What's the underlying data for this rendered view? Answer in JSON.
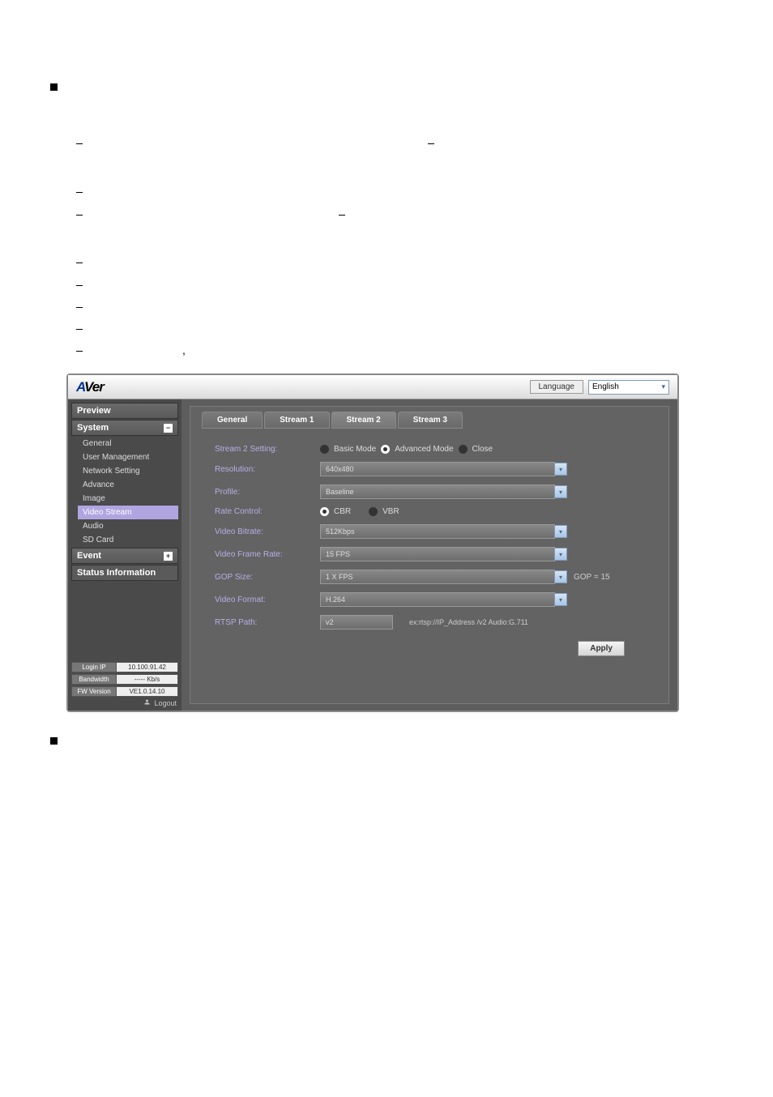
{
  "header": {
    "logo_a": "A",
    "logo_v": "V",
    "logo_er": "er",
    "language_label": "Language",
    "language_value": "English"
  },
  "sidebar": {
    "preview_label": "Preview",
    "system_label": "System",
    "system_items": [
      "General",
      "User Management",
      "Network Setting",
      "Advance",
      "Image",
      "Video Stream",
      "Audio",
      "SD Card"
    ],
    "event_label": "Event",
    "status_label": "Status Information",
    "stats": [
      {
        "label": "Login IP",
        "value": "10.100.91.42"
      },
      {
        "label": "Bandwidth",
        "value": "----- Kb/s"
      },
      {
        "label": "FW Version",
        "value": "VE1.0.14.10"
      }
    ],
    "logout_label": "Logout"
  },
  "tabs": [
    "General",
    "Stream 1",
    "Stream 2",
    "Stream 3"
  ],
  "form": {
    "setting_label": "Stream 2 Setting:",
    "setting_opts": [
      "Basic Mode",
      "Advanced Mode",
      "Close"
    ],
    "resolution_label": "Resolution:",
    "resolution_value": "640x480",
    "profile_label": "Profile:",
    "profile_value": "Baseline",
    "rate_label": "Rate Control:",
    "rate_opts": [
      "CBR",
      "VBR"
    ],
    "bitrate_label": "Video Bitrate:",
    "bitrate_value": "512Kbps",
    "fps_label": "Video Frame Rate:",
    "fps_value": "15 FPS",
    "gop_label": "GOP Size:",
    "gop_value": "1 X FPS",
    "gop_hint": "GOP = 15",
    "format_label": "Video Format:",
    "format_value": "H.264",
    "rtsp_label": "RTSP Path:",
    "rtsp_value": "v2",
    "rtsp_hint": "ex:rtsp://IP_Address /v2   Audio:G.711",
    "apply_label": "Apply"
  }
}
